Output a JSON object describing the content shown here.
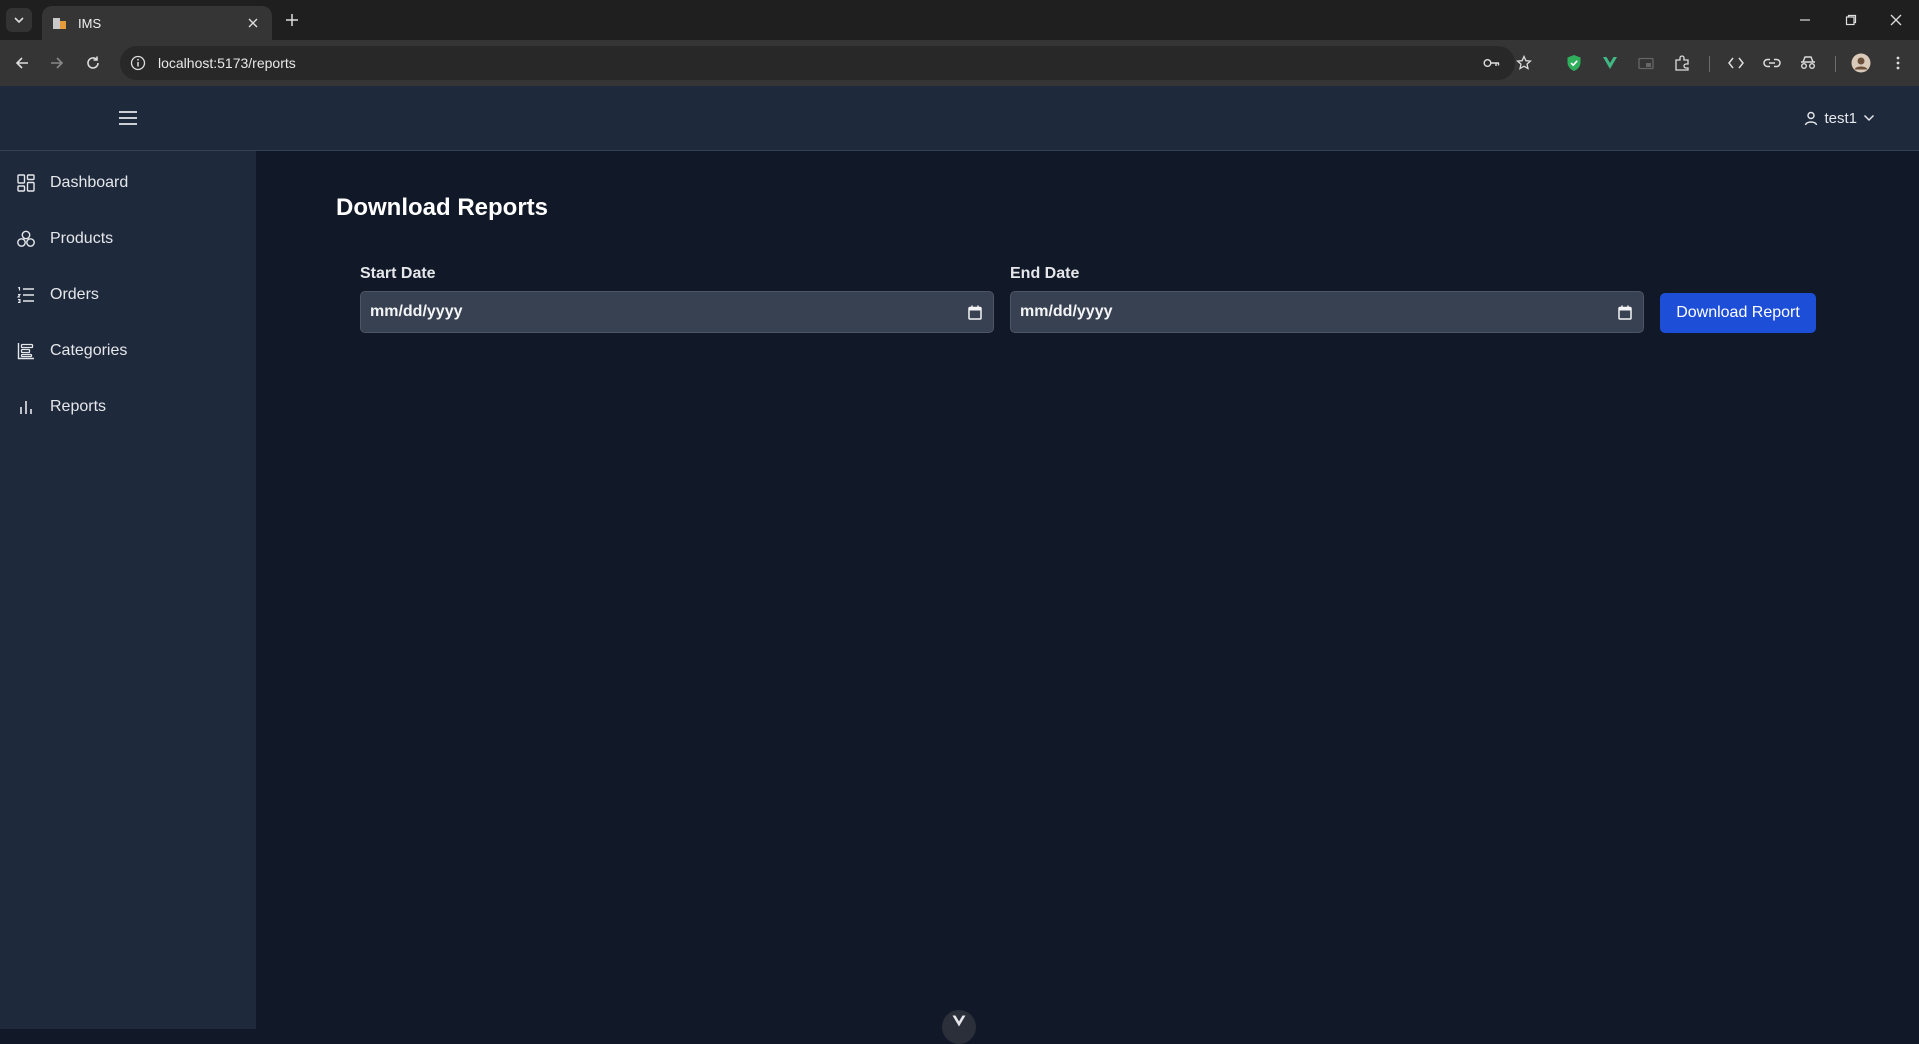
{
  "browser": {
    "tab_title": "IMS",
    "url": "localhost:5173/reports"
  },
  "header": {
    "user_name": "test1"
  },
  "sidebar": {
    "items": [
      {
        "label": "Dashboard",
        "icon": "dashboard-icon"
      },
      {
        "label": "Products",
        "icon": "products-icon"
      },
      {
        "label": "Orders",
        "icon": "orders-icon"
      },
      {
        "label": "Categories",
        "icon": "categories-icon"
      },
      {
        "label": "Reports",
        "icon": "bar-chart-icon"
      }
    ]
  },
  "main": {
    "title": "Download Reports",
    "start_date": {
      "label": "Start Date",
      "placeholder": "mm/dd/yyyy"
    },
    "end_date": {
      "label": "End Date",
      "placeholder": "mm/dd/yyyy"
    },
    "download_button": "Download Report"
  },
  "colors": {
    "background": "#111827",
    "panel": "#1e293b",
    "input": "#374151",
    "accent": "#1d4ed8"
  }
}
